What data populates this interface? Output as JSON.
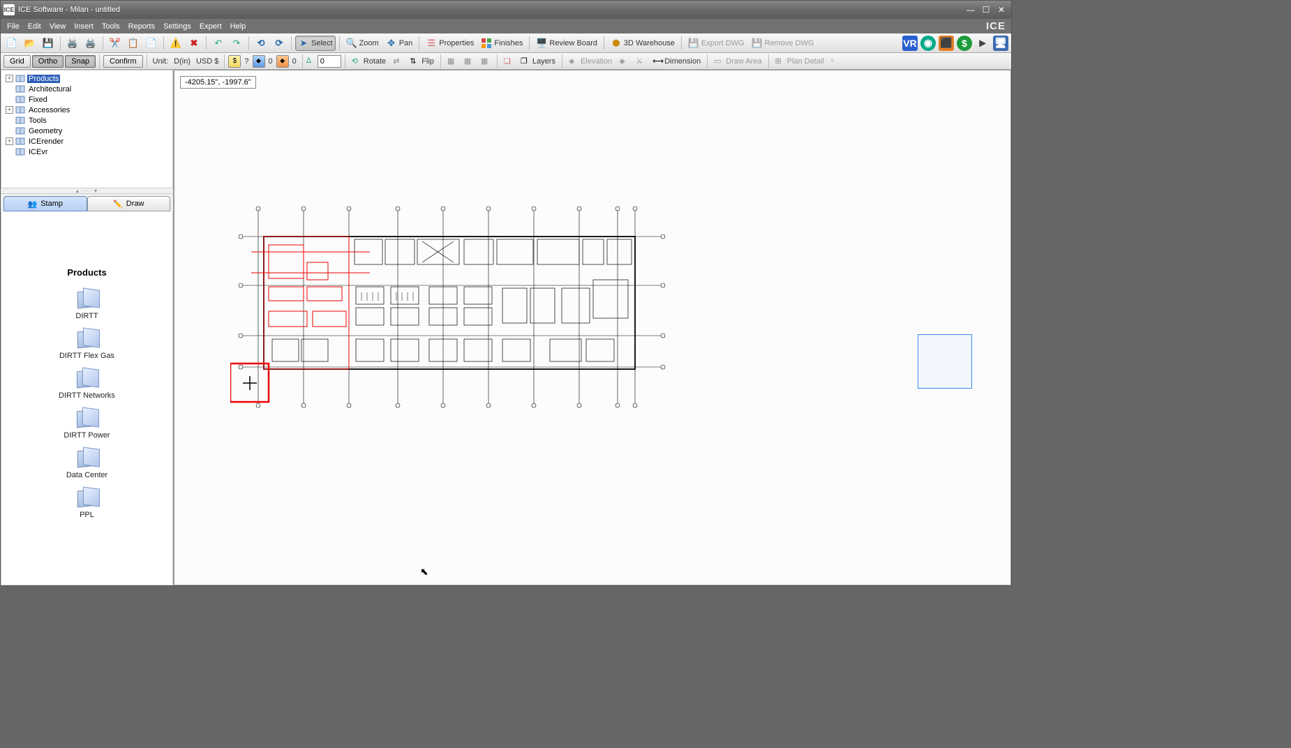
{
  "titlebar": {
    "app_icon": "ICE",
    "title": "ICE Software - Milan - untitled"
  },
  "menubar": {
    "items": [
      "File",
      "Edit",
      "View",
      "Insert",
      "Tools",
      "Reports",
      "Settings",
      "Expert",
      "Help"
    ],
    "logo": "ICE"
  },
  "toolbar_main": {
    "select": "Select",
    "zoom": "Zoom",
    "pan": "Pan",
    "properties": "Properties",
    "finishes": "Finishes",
    "review_board": "Review Board",
    "warehouse": "3D Warehouse",
    "export_dwg": "Export DWG",
    "remove_dwg": "Remove DWG"
  },
  "toolbar_sub": {
    "grid": "Grid",
    "ortho": "Ortho",
    "snap": "Snap",
    "confirm": "Confirm",
    "unit_label": "Unit:",
    "unit_value": "D(in)",
    "currency": "USD $",
    "dollar_q": "?",
    "count_a": "0",
    "count_b": "0",
    "delta": "0",
    "rotate": "Rotate",
    "flip": "Flip",
    "layers": "Layers",
    "elevation": "Elevation",
    "dimension": "Dimension",
    "draw_area": "Draw Area",
    "plan_detail": "Plan Detail"
  },
  "tree": {
    "items": [
      {
        "label": "Products",
        "expandable": true,
        "selected": true
      },
      {
        "label": "Architectural",
        "expandable": false
      },
      {
        "label": "Fixed",
        "expandable": false
      },
      {
        "label": "Accessories",
        "expandable": true
      },
      {
        "label": "Tools",
        "expandable": false
      },
      {
        "label": "Geometry",
        "expandable": false
      },
      {
        "label": "ICErender",
        "expandable": true
      },
      {
        "label": "ICEvr",
        "expandable": false
      }
    ]
  },
  "tabs": {
    "stamp": "Stamp",
    "draw": "Draw"
  },
  "products": {
    "title": "Products",
    "items": [
      "DIRTT",
      "DIRTT Flex Gas",
      "DIRTT Networks",
      "DIRTT Power",
      "Data Center",
      "PPL"
    ]
  },
  "canvas": {
    "coord": "-4205.15\", -1997.6\""
  }
}
